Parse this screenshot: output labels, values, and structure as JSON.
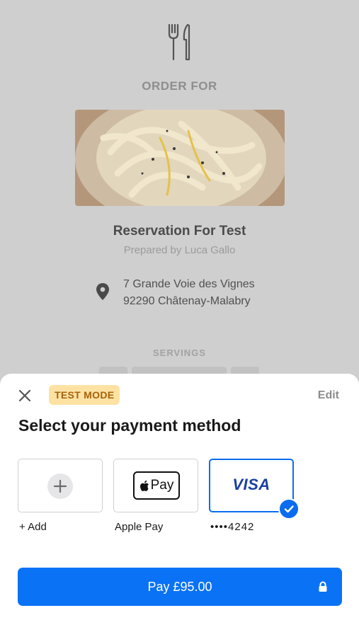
{
  "background": {
    "utensils_icon": "fork-knife-icon",
    "order_for": "ORDER FOR",
    "image_alt": "pasta dish",
    "title": "Reservation For Test",
    "prepared_by": "Prepared by Luca Gallo",
    "address_line1": "7 Grande Voie des Vignes",
    "address_line2": "92290 Châtenay-Malabry",
    "location_icon": "map-pin-icon",
    "servings_label": "SERVINGS"
  },
  "sheet": {
    "close_icon": "close-icon",
    "badge": "TEST MODE",
    "edit": "Edit",
    "title": "Select your payment method",
    "methods": [
      {
        "label": "+ Add",
        "icon": "plus-icon"
      },
      {
        "label": "Apple Pay",
        "icon": "apple-pay-icon",
        "mark": "Pay"
      },
      {
        "label": "••••4242",
        "icon": "visa-icon",
        "mark": "VISA",
        "selected": true
      }
    ],
    "pay_button": "Pay £95.00",
    "lock_icon": "lock-icon"
  },
  "colors": {
    "accent": "#0a72f5",
    "badge_bg": "#fde2a3",
    "badge_text": "#a6620a",
    "visa": "#1a3fa0"
  }
}
